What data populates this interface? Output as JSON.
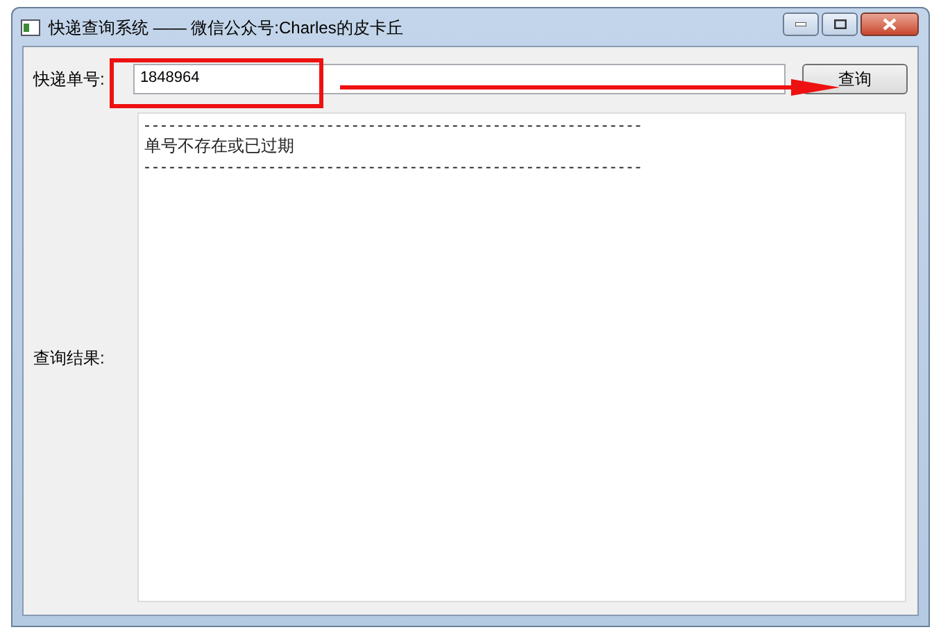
{
  "window": {
    "title": "快递查询系统 —— 微信公众号:Charles的皮卡丘"
  },
  "form": {
    "tracking_label": "快递单号:",
    "tracking_value": "1848964",
    "query_button": "查询",
    "result_label": "查询结果:",
    "result_lines": [
      "------------------------------------------------------------",
      "单号不存在或已过期",
      "------------------------------------------------------------"
    ]
  },
  "annotation": {
    "kind": "highlight-arrow"
  }
}
